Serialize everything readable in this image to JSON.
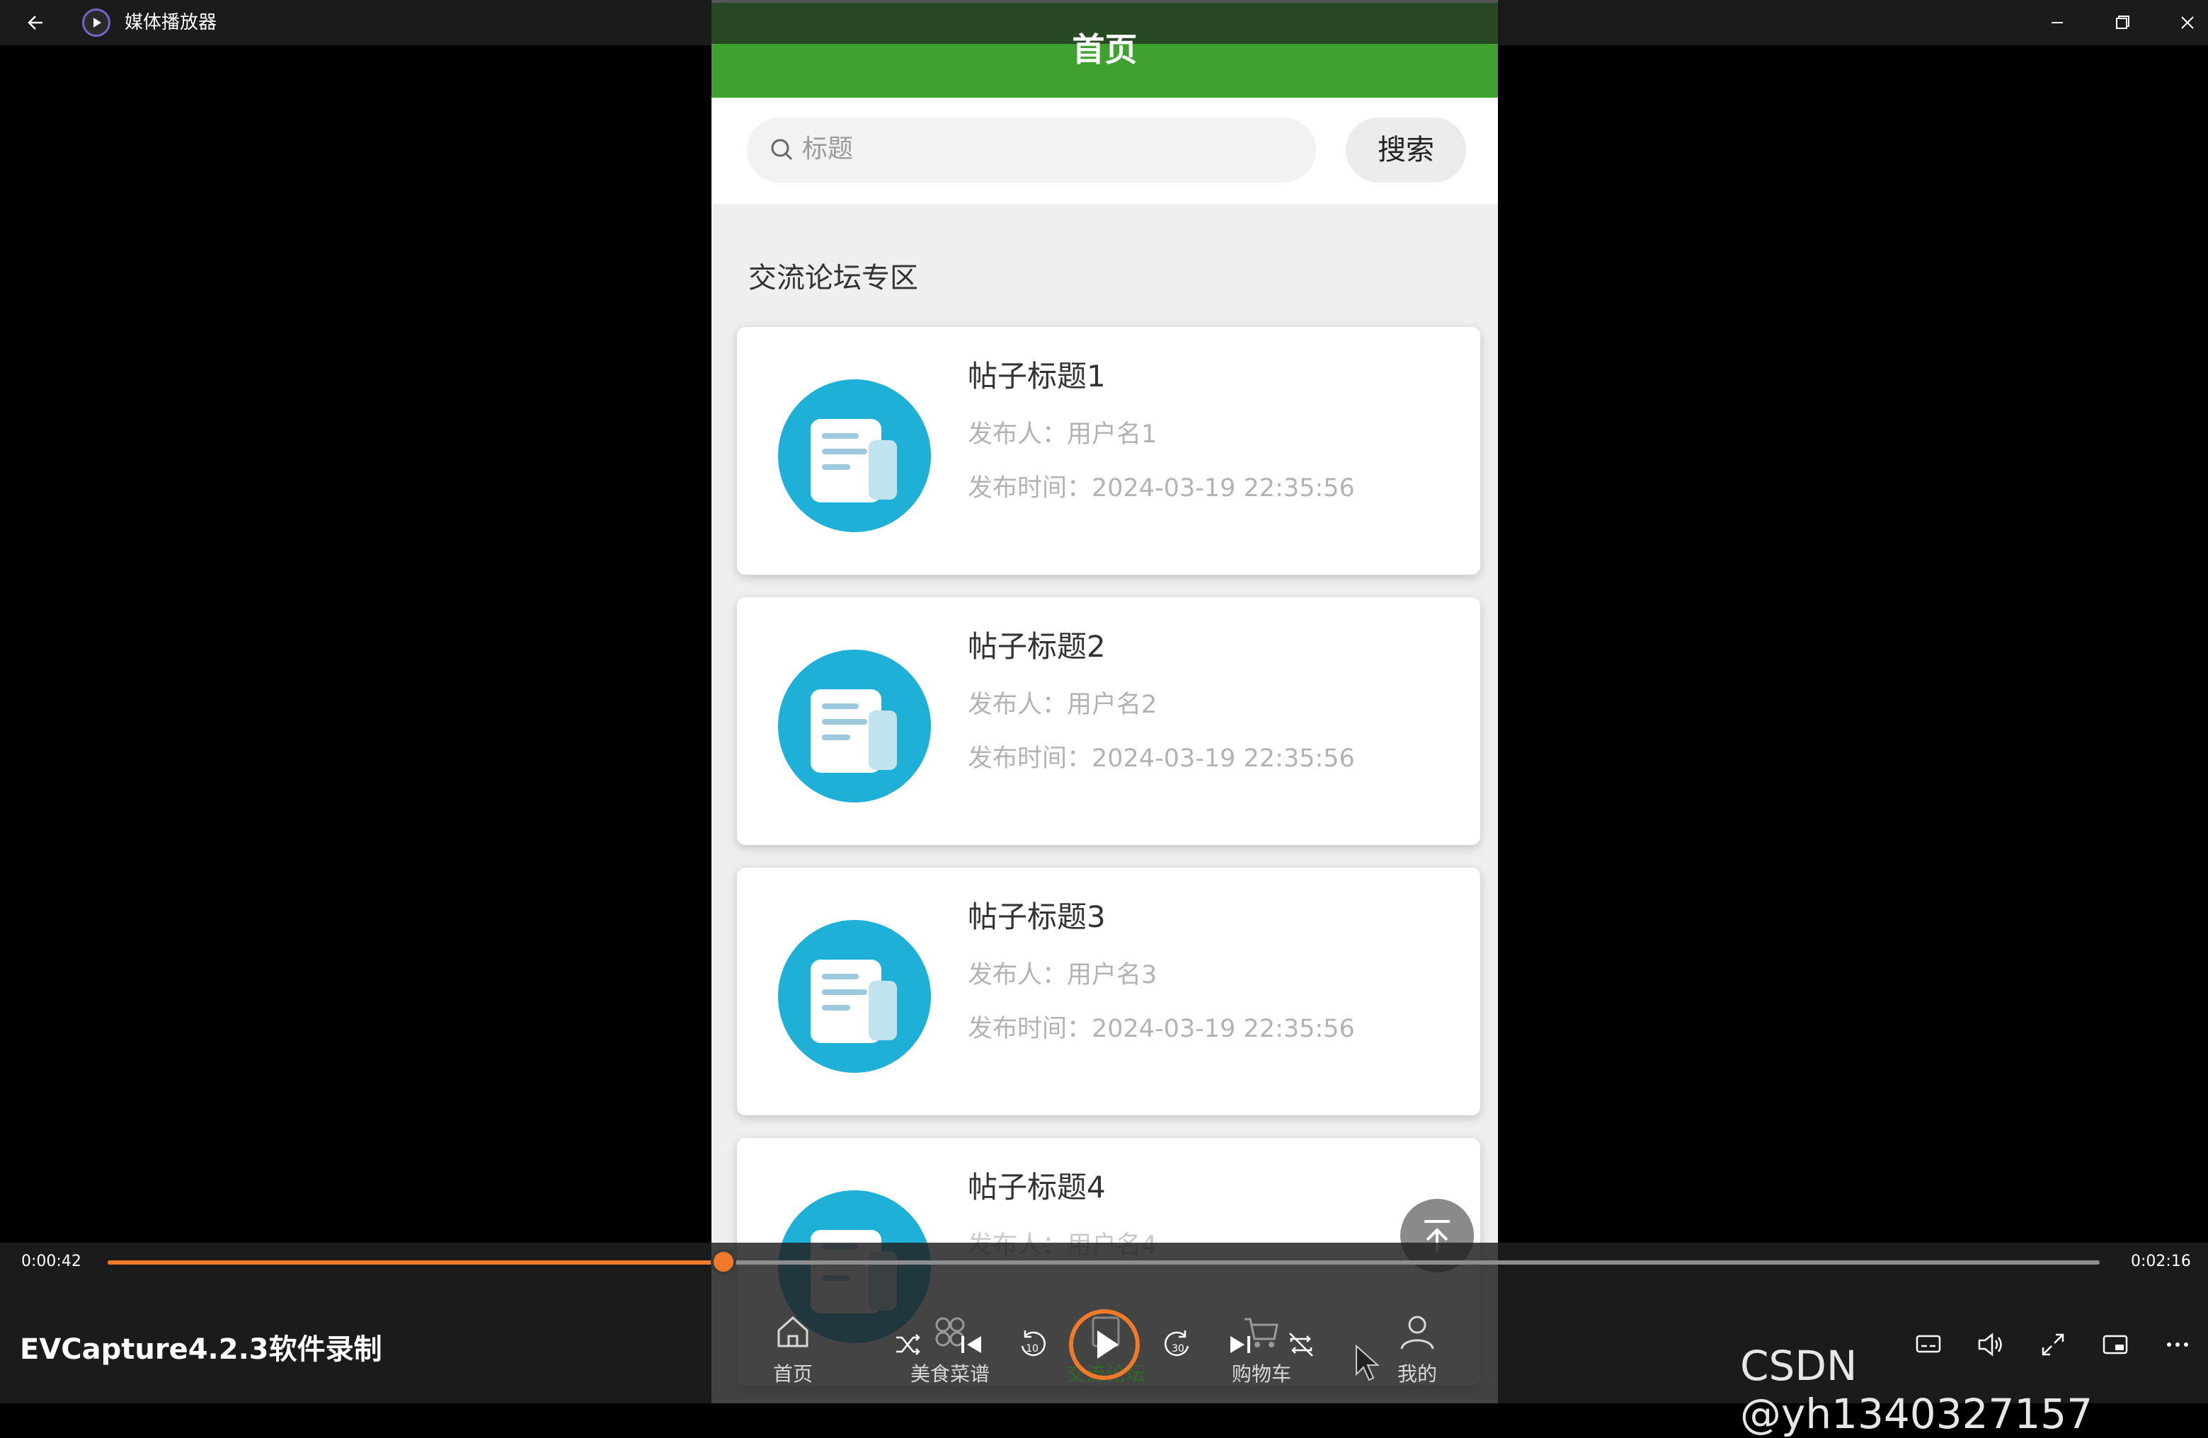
{
  "window": {
    "title": "媒体播放器",
    "back_icon": "back-arrow-icon",
    "app_icon": "media-player-icon",
    "controls": [
      "minimize-icon",
      "restore-icon",
      "close-icon"
    ]
  },
  "phone": {
    "header_title": "首页",
    "search": {
      "placeholder": "标题",
      "button_label": "搜索"
    },
    "section_title": "交流论坛专区",
    "posts": [
      {
        "title": "帖子标题1",
        "author": "发布人：用户名1",
        "time": "发布时间：2024-03-19 22:35:56"
      },
      {
        "title": "帖子标题2",
        "author": "发布人：用户名2",
        "time": "发布时间：2024-03-19 22:35:56"
      },
      {
        "title": "帖子标题3",
        "author": "发布人：用户名3",
        "time": "发布时间：2024-03-19 22:35:56"
      },
      {
        "title": "帖子标题4",
        "author": "发布人：用户名4",
        "time": ""
      }
    ],
    "tabbar": [
      {
        "label": "首页",
        "icon": "home-icon"
      },
      {
        "label": "美食菜谱",
        "icon": "grid-icon"
      },
      {
        "label": "交流论坛",
        "icon": "forum-icon"
      },
      {
        "label": "购物车",
        "icon": "cart-icon"
      },
      {
        "label": "我的",
        "icon": "user-icon"
      }
    ],
    "colors": {
      "header": "#3fa12f",
      "post_icon": "#1fb0d8"
    }
  },
  "player": {
    "elapsed": "0:00:42",
    "duration": "0:02:16",
    "progress": 0.309,
    "accent": "#f07a2a",
    "watermark_left": "EVCapture4.2.3软件录制",
    "watermark_right": "CSDN @yh1340327157",
    "controls": [
      "shuffle-icon",
      "previous-icon",
      "rewind-10-icon",
      "play-icon",
      "forward-30-icon",
      "next-icon",
      "repeat-icon",
      "subtitles-icon",
      "volume-icon",
      "fullscreen-icon",
      "miniplayer-icon",
      "more-icon"
    ]
  }
}
